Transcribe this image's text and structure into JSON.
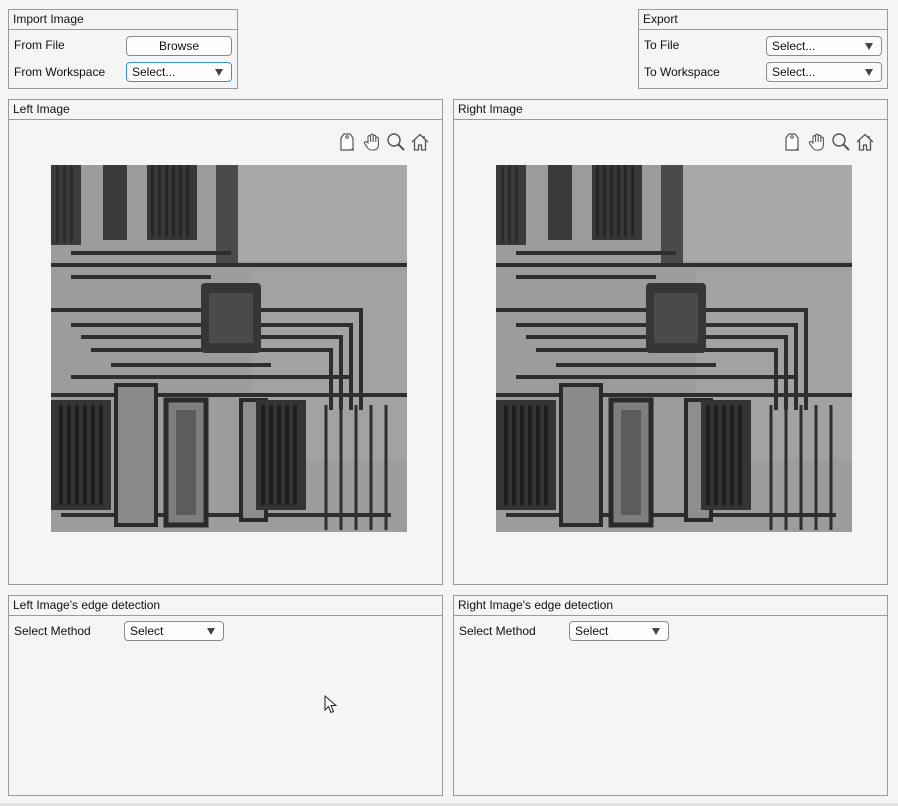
{
  "import_panel": {
    "title": "Import Image",
    "from_file_label": "From File",
    "browse_label": "Browse",
    "from_workspace_label": "From Workspace",
    "workspace_value": "Select..."
  },
  "export_panel": {
    "title": "Export",
    "to_file_label": "To File",
    "to_file_value": "Select...",
    "to_workspace_label": "To Workspace",
    "to_workspace_value": "Select..."
  },
  "left_image_panel": {
    "title": "Left Image",
    "toolbar": [
      "tag-icon",
      "pan-hand-icon",
      "zoom-magnifier-icon",
      "home-icon"
    ]
  },
  "right_image_panel": {
    "title": "Right Image",
    "toolbar": [
      "tag-icon",
      "pan-hand-icon",
      "zoom-magnifier-icon",
      "home-icon"
    ]
  },
  "left_edge_panel": {
    "title": "Left Image's edge detection",
    "method_label": "Select Method",
    "method_value": "Select"
  },
  "right_edge_panel": {
    "title": "Right Image's edge detection",
    "method_label": "Select Method",
    "method_value": "Select"
  },
  "colors": {
    "background": "#f5f5f5",
    "border": "#9a9a9a",
    "focus": "#3a8fd6"
  }
}
